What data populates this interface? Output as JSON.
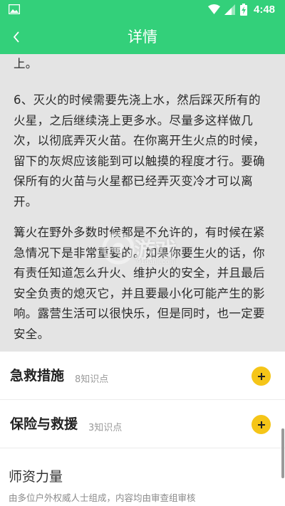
{
  "status_bar": {
    "time": "4:48",
    "icons": [
      "gallery-icon",
      "wifi-icon",
      "signal-icon",
      "battery-charging-icon"
    ]
  },
  "app_bar": {
    "title": "详情",
    "back_icon": "chevron-left-icon"
  },
  "article": {
    "paragraphs": [
      "上。",
      "6、灭火的时候需要先浇上水，然后踩灭所有的火星，之后继续浇上更多水。尽量多这样做几次，以彻底弄灭火苗。在你离开生火点的时候，留下的灰烬应该能到可以触摸的程度才行。要确保所有的火苗与火星都已经弄灭变冷才可以离开。",
      "篝火在野外多数时候都是不允许的，有时候在紧急情况下是非常重要的。如果你要生火的话，你有责任知道怎么升火、维护火的安全，并且最后安全负责的熄灭它，并且要最小化可能产生的影响。露营生活可以很快乐，但是同时，也一定要安全。"
    ],
    "watermark": {
      "main": "游戏",
      "sub": "91danji.com"
    }
  },
  "sections": [
    {
      "title": "急救措施",
      "count": "8知识点",
      "action_icon": "plus-icon"
    },
    {
      "title": "保险与救援",
      "count": "3知识点",
      "action_icon": "plus-icon"
    }
  ],
  "faculty": {
    "title": "师资力量",
    "subtitle": "由多位户外权威人士组成，内容均由审查组审核"
  },
  "colors": {
    "primary": "#33d07a",
    "accent": "#f5c518",
    "article_bg": "#e4e4e4"
  }
}
